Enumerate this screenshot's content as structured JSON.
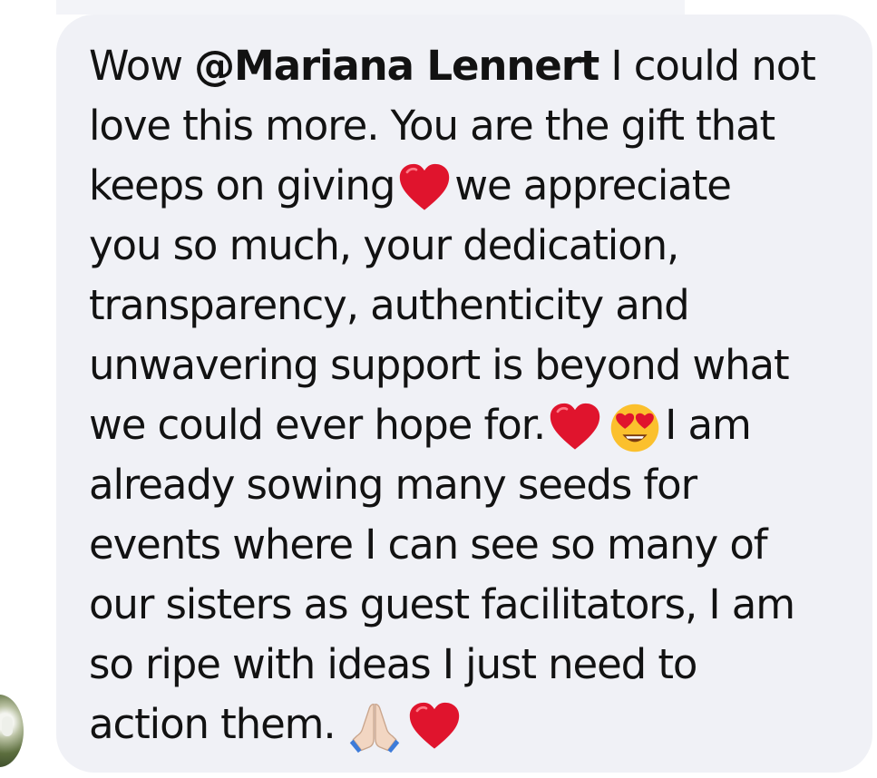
{
  "comment": {
    "line1_pre": "Wow ",
    "mention": "@Mariana Lennert",
    "line1_post": " I could not",
    "line2": "love this more. You are the gift that",
    "line3_pre": "keeps on giving",
    "line3_post": "we appreciate",
    "line4": "you so much, your dedication,",
    "line5": "transparency, authenticity and",
    "line6": "unwavering support is beyond what",
    "line7_pre": "we could ever hope for.",
    "line7_post": "I am",
    "line8": "already sowing many seeds for",
    "line9": "events where I can see so many of",
    "line10": "our sisters as guest facilitators, I am",
    "line11": "so ripe with ideas I just need to",
    "line12": "action them."
  },
  "emojis": [
    "red-heart",
    "red-heart",
    "heart-eyes-face",
    "folded-hands",
    "red-heart"
  ],
  "colors": {
    "bubble": "#f0f1f6",
    "text": "#121212",
    "heart": "#e0142d",
    "face": "#fbc02d"
  }
}
